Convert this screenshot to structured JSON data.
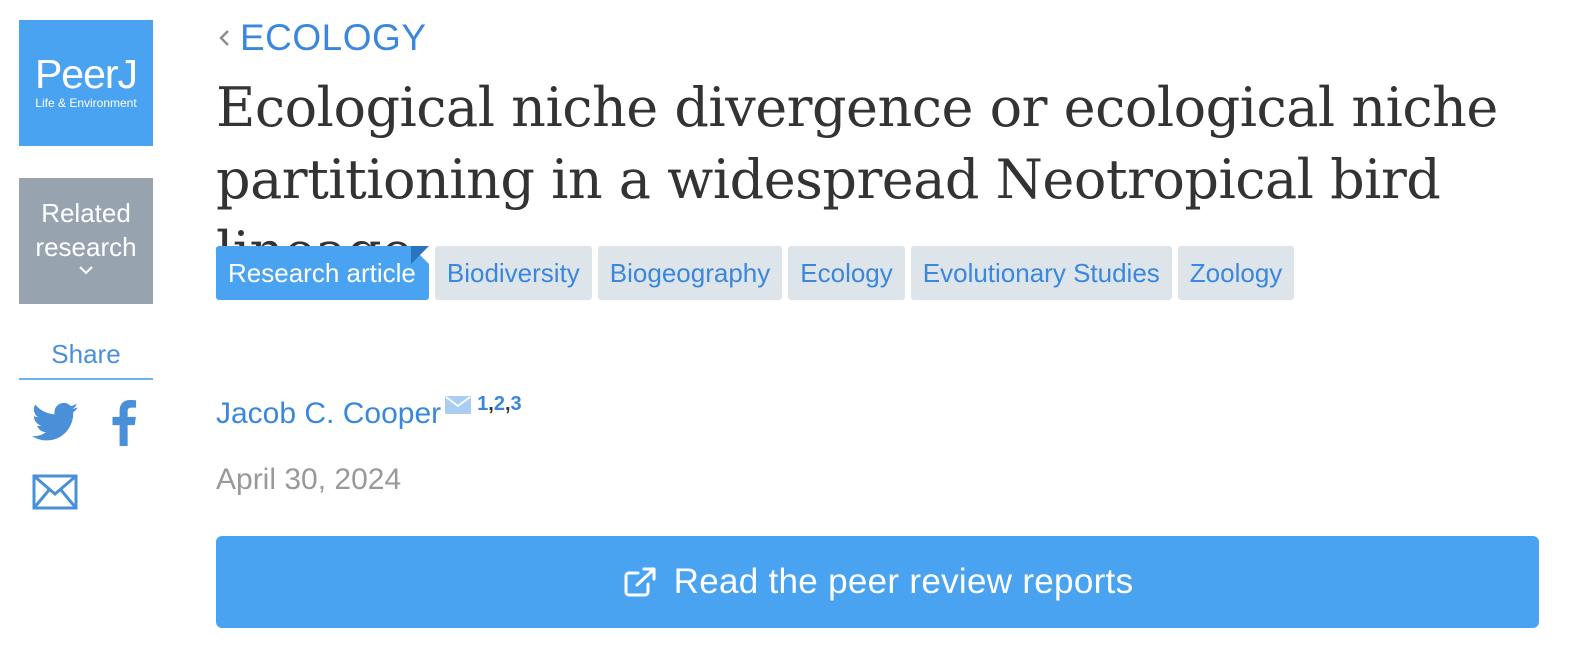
{
  "logo": {
    "word": "PeerJ",
    "subtitle": "Life & Environment"
  },
  "related": {
    "label": "Related research"
  },
  "share": {
    "label": "Share",
    "icons": [
      "twitter-icon",
      "facebook-icon",
      "email-icon"
    ]
  },
  "breadcrumb": {
    "label": "ECOLOGY",
    "icon": "chevron-left-icon"
  },
  "article": {
    "title": "Ecological niche divergence or ecological niche partitioning in a widespread Neotropical bird lineage",
    "tags": [
      {
        "label": "Research article",
        "kind": "article-type"
      },
      {
        "label": "Biodiversity",
        "kind": "subject"
      },
      {
        "label": "Biogeography",
        "kind": "subject"
      },
      {
        "label": "Ecology",
        "kind": "subject"
      },
      {
        "label": "Evolutionary Studies",
        "kind": "subject"
      },
      {
        "label": "Zoology",
        "kind": "subject"
      }
    ],
    "author": {
      "name": "Jacob C. Cooper",
      "affiliations": [
        "1",
        "2",
        "3"
      ],
      "separator": ","
    },
    "date": "April 30, 2024"
  },
  "review_button": {
    "label": "Read the peer review reports",
    "icon": "external-link-icon"
  },
  "colors": {
    "brand_blue": "#4aa3f0",
    "link_blue": "#3a87dd",
    "related_gray": "#97a4b0",
    "tag_bg": "#dde4ea",
    "date_gray": "#999999"
  }
}
